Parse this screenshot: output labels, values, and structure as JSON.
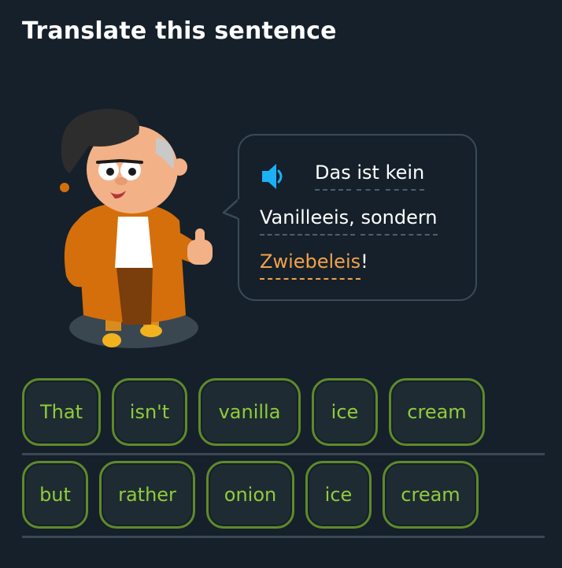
{
  "header": {
    "title": "Translate this sentence"
  },
  "prompt": {
    "audio_icon": "speaker-icon",
    "lines": [
      [
        "Das",
        "ist",
        "kein"
      ],
      [
        "Vanilleeis,",
        "sondern"
      ],
      [
        "Zwiebeleis",
        "!"
      ]
    ],
    "highlight_color": "#f2a24a"
  },
  "word_bank": {
    "row1": [
      "That",
      "isn't",
      "vanilla",
      "ice",
      "cream"
    ],
    "row2": [
      "but",
      "rather",
      "onion",
      "ice",
      "cream"
    ],
    "chip_border_color": "#5f8a2a",
    "chip_text_color": "#8fcc3a"
  }
}
